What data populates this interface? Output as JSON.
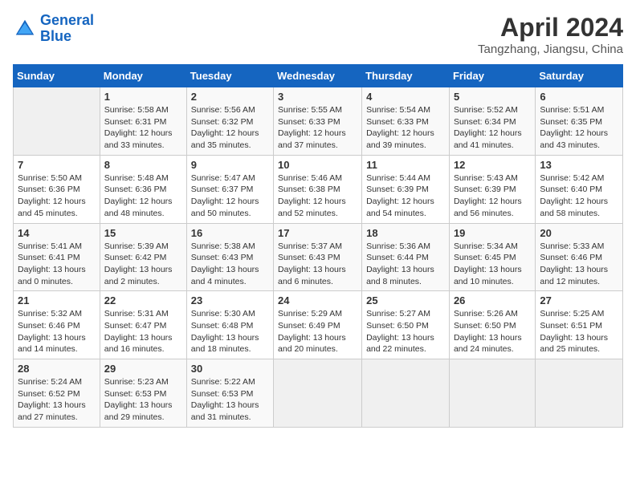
{
  "header": {
    "logo_line1": "General",
    "logo_line2": "Blue",
    "title": "April 2024",
    "subtitle": "Tangzhang, Jiangsu, China"
  },
  "weekdays": [
    "Sunday",
    "Monday",
    "Tuesday",
    "Wednesday",
    "Thursday",
    "Friday",
    "Saturday"
  ],
  "weeks": [
    [
      {
        "date": "",
        "text": ""
      },
      {
        "date": "1",
        "text": "Sunrise: 5:58 AM\nSunset: 6:31 PM\nDaylight: 12 hours\nand 33 minutes."
      },
      {
        "date": "2",
        "text": "Sunrise: 5:56 AM\nSunset: 6:32 PM\nDaylight: 12 hours\nand 35 minutes."
      },
      {
        "date": "3",
        "text": "Sunrise: 5:55 AM\nSunset: 6:33 PM\nDaylight: 12 hours\nand 37 minutes."
      },
      {
        "date": "4",
        "text": "Sunrise: 5:54 AM\nSunset: 6:33 PM\nDaylight: 12 hours\nand 39 minutes."
      },
      {
        "date": "5",
        "text": "Sunrise: 5:52 AM\nSunset: 6:34 PM\nDaylight: 12 hours\nand 41 minutes."
      },
      {
        "date": "6",
        "text": "Sunrise: 5:51 AM\nSunset: 6:35 PM\nDaylight: 12 hours\nand 43 minutes."
      }
    ],
    [
      {
        "date": "7",
        "text": "Sunrise: 5:50 AM\nSunset: 6:36 PM\nDaylight: 12 hours\nand 45 minutes."
      },
      {
        "date": "8",
        "text": "Sunrise: 5:48 AM\nSunset: 6:36 PM\nDaylight: 12 hours\nand 48 minutes."
      },
      {
        "date": "9",
        "text": "Sunrise: 5:47 AM\nSunset: 6:37 PM\nDaylight: 12 hours\nand 50 minutes."
      },
      {
        "date": "10",
        "text": "Sunrise: 5:46 AM\nSunset: 6:38 PM\nDaylight: 12 hours\nand 52 minutes."
      },
      {
        "date": "11",
        "text": "Sunrise: 5:44 AM\nSunset: 6:39 PM\nDaylight: 12 hours\nand 54 minutes."
      },
      {
        "date": "12",
        "text": "Sunrise: 5:43 AM\nSunset: 6:39 PM\nDaylight: 12 hours\nand 56 minutes."
      },
      {
        "date": "13",
        "text": "Sunrise: 5:42 AM\nSunset: 6:40 PM\nDaylight: 12 hours\nand 58 minutes."
      }
    ],
    [
      {
        "date": "14",
        "text": "Sunrise: 5:41 AM\nSunset: 6:41 PM\nDaylight: 13 hours\nand 0 minutes."
      },
      {
        "date": "15",
        "text": "Sunrise: 5:39 AM\nSunset: 6:42 PM\nDaylight: 13 hours\nand 2 minutes."
      },
      {
        "date": "16",
        "text": "Sunrise: 5:38 AM\nSunset: 6:43 PM\nDaylight: 13 hours\nand 4 minutes."
      },
      {
        "date": "17",
        "text": "Sunrise: 5:37 AM\nSunset: 6:43 PM\nDaylight: 13 hours\nand 6 minutes."
      },
      {
        "date": "18",
        "text": "Sunrise: 5:36 AM\nSunset: 6:44 PM\nDaylight: 13 hours\nand 8 minutes."
      },
      {
        "date": "19",
        "text": "Sunrise: 5:34 AM\nSunset: 6:45 PM\nDaylight: 13 hours\nand 10 minutes."
      },
      {
        "date": "20",
        "text": "Sunrise: 5:33 AM\nSunset: 6:46 PM\nDaylight: 13 hours\nand 12 minutes."
      }
    ],
    [
      {
        "date": "21",
        "text": "Sunrise: 5:32 AM\nSunset: 6:46 PM\nDaylight: 13 hours\nand 14 minutes."
      },
      {
        "date": "22",
        "text": "Sunrise: 5:31 AM\nSunset: 6:47 PM\nDaylight: 13 hours\nand 16 minutes."
      },
      {
        "date": "23",
        "text": "Sunrise: 5:30 AM\nSunset: 6:48 PM\nDaylight: 13 hours\nand 18 minutes."
      },
      {
        "date": "24",
        "text": "Sunrise: 5:29 AM\nSunset: 6:49 PM\nDaylight: 13 hours\nand 20 minutes."
      },
      {
        "date": "25",
        "text": "Sunrise: 5:27 AM\nSunset: 6:50 PM\nDaylight: 13 hours\nand 22 minutes."
      },
      {
        "date": "26",
        "text": "Sunrise: 5:26 AM\nSunset: 6:50 PM\nDaylight: 13 hours\nand 24 minutes."
      },
      {
        "date": "27",
        "text": "Sunrise: 5:25 AM\nSunset: 6:51 PM\nDaylight: 13 hours\nand 25 minutes."
      }
    ],
    [
      {
        "date": "28",
        "text": "Sunrise: 5:24 AM\nSunset: 6:52 PM\nDaylight: 13 hours\nand 27 minutes."
      },
      {
        "date": "29",
        "text": "Sunrise: 5:23 AM\nSunset: 6:53 PM\nDaylight: 13 hours\nand 29 minutes."
      },
      {
        "date": "30",
        "text": "Sunrise: 5:22 AM\nSunset: 6:53 PM\nDaylight: 13 hours\nand 31 minutes."
      },
      {
        "date": "",
        "text": ""
      },
      {
        "date": "",
        "text": ""
      },
      {
        "date": "",
        "text": ""
      },
      {
        "date": "",
        "text": ""
      }
    ]
  ]
}
